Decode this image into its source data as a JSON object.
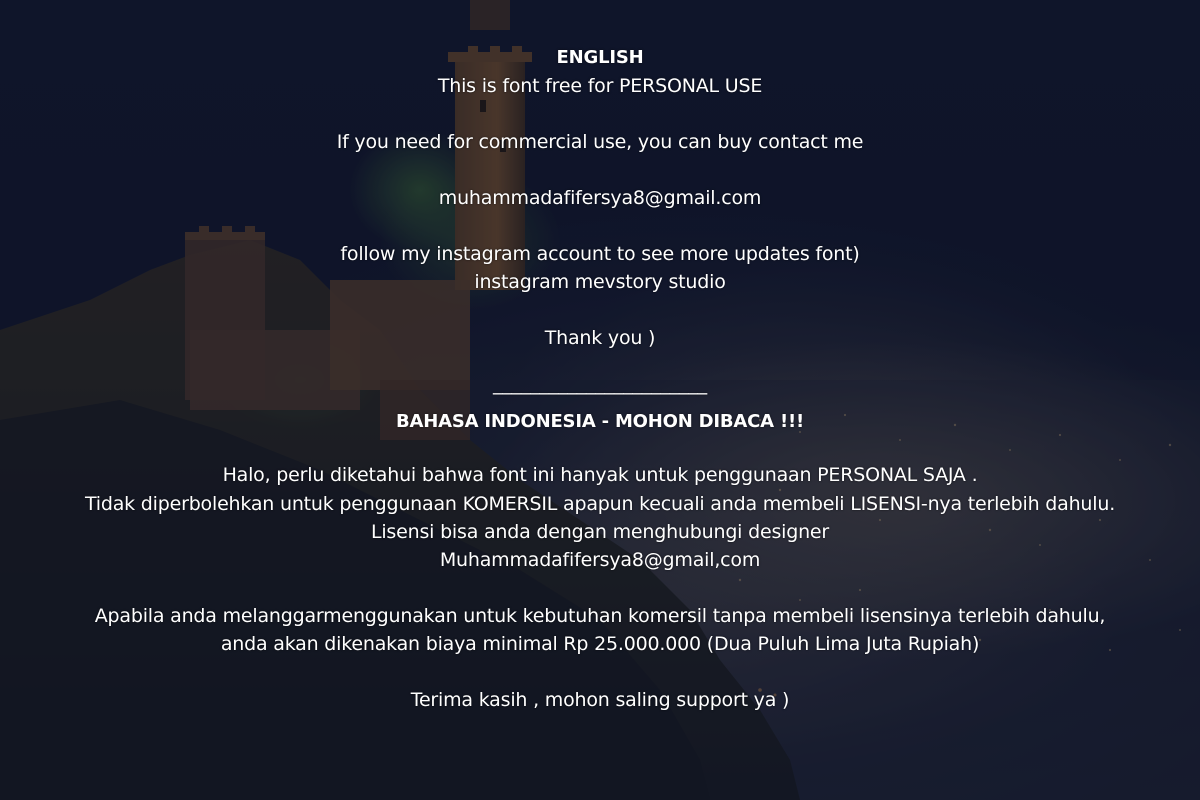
{
  "english": {
    "heading": "ENGLISH",
    "line1": "This is font free for PERSONAL USE",
    "line2": "If you need for commercial use, you can buy contact me",
    "email": "muhammadafifersya8@gmail.com",
    "line3": "follow my instagram account to see more updates font)",
    "line4": "instagram  mevstory studio",
    "thanks": "Thank you )"
  },
  "divider": "_______________________",
  "indonesia": {
    "heading": "BAHASA INDONESIA - MOHON DIBACA !!!",
    "line1": "Halo, perlu diketahui bahwa font ini hanyak untuk penggunaan PERSONAL SAJA .",
    "line2": "Tidak diperbolehkan untuk penggunaan KOMERSIL apapun kecuali anda membeli LISENSI-nya terlebih dahulu.",
    "line3": "Lisensi bisa anda dengan menghubungi designer",
    "email": "Muhammadafifersya8@gmail,com",
    "line4": "Apabila anda melanggarmenggunakan untuk kebutuhan komersil tanpa membeli lisensinya terlebih dahulu,",
    "line5": "anda akan dikenakan biaya minimal Rp 25.000.000 (Dua Puluh Lima Juta Rupiah)",
    "closing": "Terima kasih , mohon saling support ya )"
  }
}
